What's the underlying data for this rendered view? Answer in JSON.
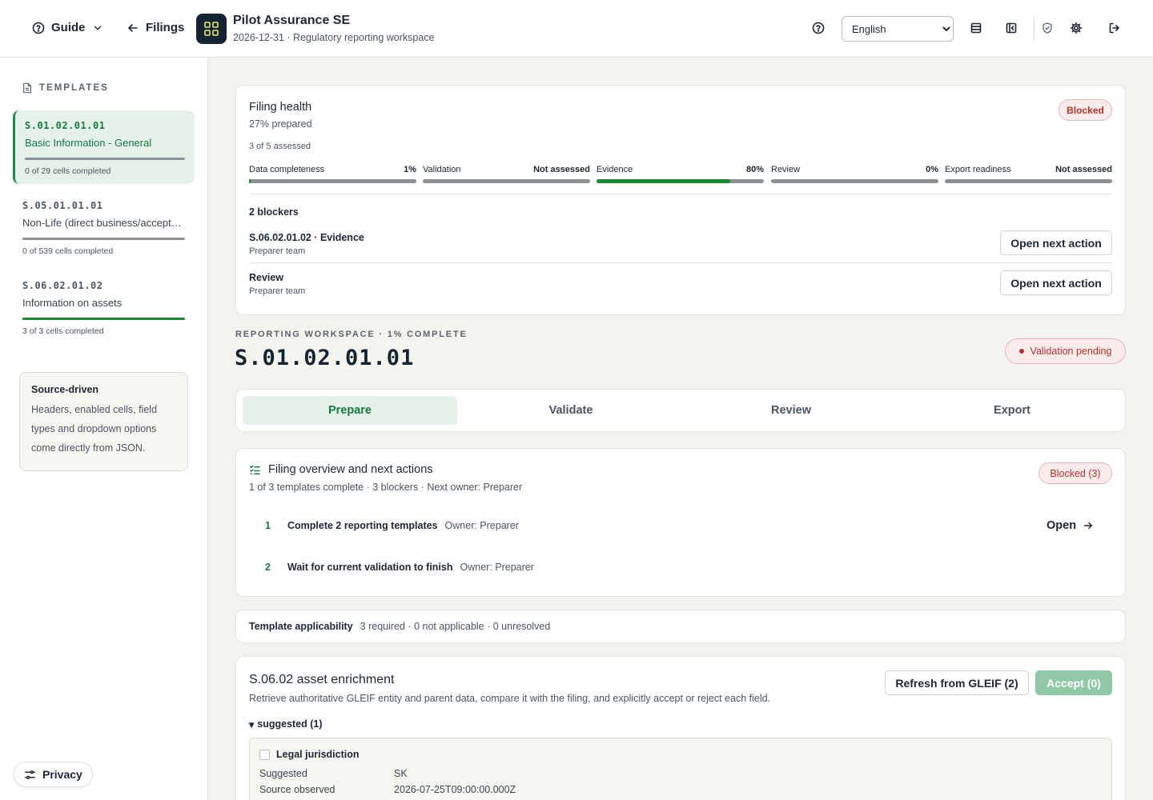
{
  "header": {
    "guide_label": "Guide",
    "filings_label": "Filings",
    "company_name": "Pilot Assurance SE",
    "company_subtitle": "2026-12-31 · Regulatory reporting workspace",
    "language": {
      "selected": "English",
      "options": [
        "English"
      ]
    },
    "icons": [
      "help-icon",
      "table-icon",
      "sidebar-toggle-icon",
      "shield-icon",
      "gear-icon",
      "logout-icon"
    ]
  },
  "sidebar": {
    "heading": "TEMPLATES",
    "templates": [
      {
        "code": "S.01.02.01.01",
        "name": "Basic Information - General",
        "count": "0 of 29 cells completed",
        "progress": 0
      },
      {
        "code": "S.05.01.01.01",
        "name": "Non-Life (direct business/accepted proportional reinsurance)",
        "count": "0 of 539 cells completed",
        "progress": 0
      },
      {
        "code": "S.06.02.01.02",
        "name": "Information on assets",
        "count": "3 of 3 cells completed",
        "progress": 1
      }
    ],
    "source": {
      "title": "Source-driven",
      "text": "Headers, enabled cells, field types and dropdown options come directly from JSON."
    },
    "privacy_label": "Privacy"
  },
  "health": {
    "title": "Filing health",
    "prepared": "27% prepared",
    "assessed": "3 of 5 assessed",
    "badge": "Blocked",
    "metrics": [
      {
        "label": "Data completeness",
        "value": "1%",
        "fill": 0.01
      },
      {
        "label": "Validation",
        "value": "Not assessed",
        "fill": 0
      },
      {
        "label": "Evidence",
        "value": "80%",
        "fill": 0.8
      },
      {
        "label": "Review",
        "value": "0%",
        "fill": 0
      },
      {
        "label": "Export readiness",
        "value": "Not assessed",
        "fill": 0
      }
    ],
    "blockers_title": "2 blockers",
    "blockers": [
      {
        "name": "S.06.02.01.02 · Evidence",
        "team": "Preparer team",
        "action": "Open next action"
      },
      {
        "name": "Review",
        "team": "Preparer team",
        "action": "Open next action"
      }
    ]
  },
  "workspace": {
    "label": "REPORTING WORKSPACE · 1% COMPLETE",
    "code": "S.01.02.01.01",
    "status": "Validation pending",
    "tabs": [
      "Prepare",
      "Validate",
      "Review",
      "Export"
    ],
    "active_tab": "Prepare"
  },
  "overview": {
    "title": "Filing overview and next actions",
    "subtitle": "1 of 3 templates complete · 3 blockers · Next owner: Preparer",
    "badge": "Blocked (3)",
    "steps": [
      {
        "num": "1",
        "title": "Complete 2 reporting templates",
        "owner": "Owner: Preparer",
        "action": "Open"
      },
      {
        "num": "2",
        "title": "Wait for current validation to finish",
        "owner": "Owner: Preparer"
      }
    ]
  },
  "applicability": {
    "title": "Template applicability",
    "text": "3 required · 0 not applicable · 0 unresolved"
  },
  "enrichment": {
    "title": "S.06.02 asset enrichment",
    "subtitle": "Retrieve authoritative GLEIF entity and parent data, compare it with the filing, and explicitly accept or reject each field.",
    "refresh_label": "Refresh from GLEIF (2)",
    "accept_label": "Accept (0)",
    "suggested_label": "suggested (1)",
    "field": {
      "title": "Legal jurisdiction",
      "rows": [
        {
          "key": "Suggested",
          "value": "SK"
        },
        {
          "key": "Source observed",
          "value": "2026-07-25T09:00:00.000Z"
        }
      ]
    }
  }
}
